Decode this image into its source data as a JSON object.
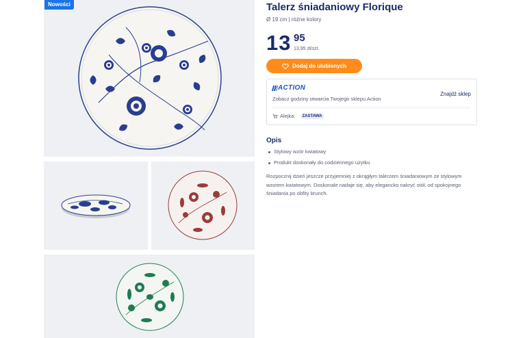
{
  "badge": {
    "new_label": "Nowości"
  },
  "gallery": {
    "main_alt": "main plate image",
    "colors": {
      "blue": "#2a3e8f",
      "red": "#9a3b3b",
      "green": "#1e7c52",
      "tile_bg": "#eef0f3"
    }
  },
  "product": {
    "title": "Talerz śniadaniowy Florique",
    "subtitle": "Ø 19 cm | różne kolory",
    "price_whole": "13",
    "price_fraction": "95",
    "unit_price": "13,95 zł/szt."
  },
  "actions": {
    "favourite_label": "Dodaj do ulubionych"
  },
  "store": {
    "brand": "ACTION",
    "hours_text": "Zobacz godziny otwarcia Twojego sklepu Action",
    "find_store": "Znajdź sklep",
    "aisle_label": "Alejka:",
    "aisle_value": "ZASTAWA"
  },
  "description": {
    "heading": "Opis",
    "bullets": [
      "Stylowy wzór kwiatowy",
      "Produkt doskonały do codziennego użytku"
    ],
    "text": "Rozpocznij dzień jeszcze przyjemniej z okrągłym talerzem śniadaniowym ze stylowym wzorem kwiatowym. Doskonale nadaje się, aby elegancko nakryć stół, od spokojnego śniadania po obfity brunch."
  },
  "icons": [
    "heart-icon",
    "cart-icon"
  ]
}
